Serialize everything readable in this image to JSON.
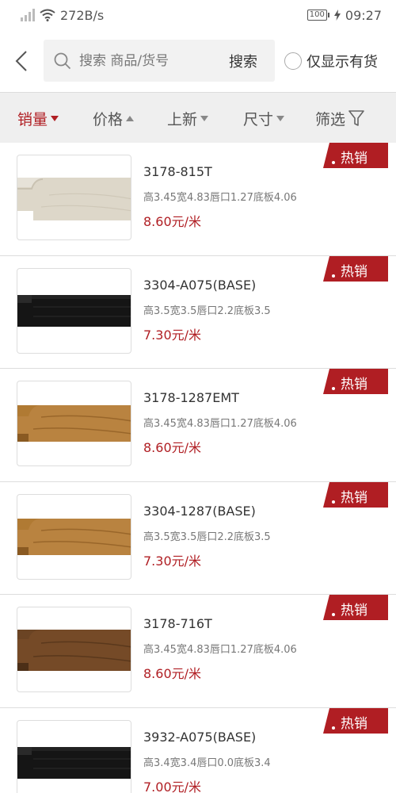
{
  "status": {
    "net_speed": "272B/s",
    "battery": "100",
    "time": "09:27"
  },
  "search": {
    "placeholder": "搜索 商品/货号",
    "button_label": "搜索",
    "stock_toggle_label": "仅显示有货"
  },
  "sort": {
    "sales": "销量",
    "price": "价格",
    "newest": "上新",
    "size": "尺寸",
    "filter": "筛选"
  },
  "colors": {
    "accent": "#b01e23",
    "sort_bg": "#efefef"
  },
  "products": [
    {
      "name": "3178-815T",
      "spec": "高3.45宽4.83唇口1.27底板4.06",
      "price": "8.60元/米",
      "badge": "热销",
      "swatch": "cream-wood"
    },
    {
      "name": "3304-A075(BASE)",
      "spec": "高3.5宽3.5唇口2.2底板3.5",
      "price": "7.30元/米",
      "badge": "热销",
      "swatch": "black"
    },
    {
      "name": "3178-1287EMT",
      "spec": "高3.45宽4.83唇口1.27底板4.06",
      "price": "8.60元/米",
      "badge": "热销",
      "swatch": "oak"
    },
    {
      "name": "3304-1287(BASE)",
      "spec": "高3.5宽3.5唇口2.2底板3.5",
      "price": "7.30元/米",
      "badge": "热销",
      "swatch": "oak"
    },
    {
      "name": "3178-716T",
      "spec": "高3.45宽4.83唇口1.27底板4.06",
      "price": "8.60元/米",
      "badge": "热销",
      "swatch": "walnut"
    },
    {
      "name": "3932-A075(BASE)",
      "spec": "高3.4宽3.4唇口0.0底板3.4",
      "price": "7.00元/米",
      "badge": "热销",
      "swatch": "black"
    }
  ]
}
